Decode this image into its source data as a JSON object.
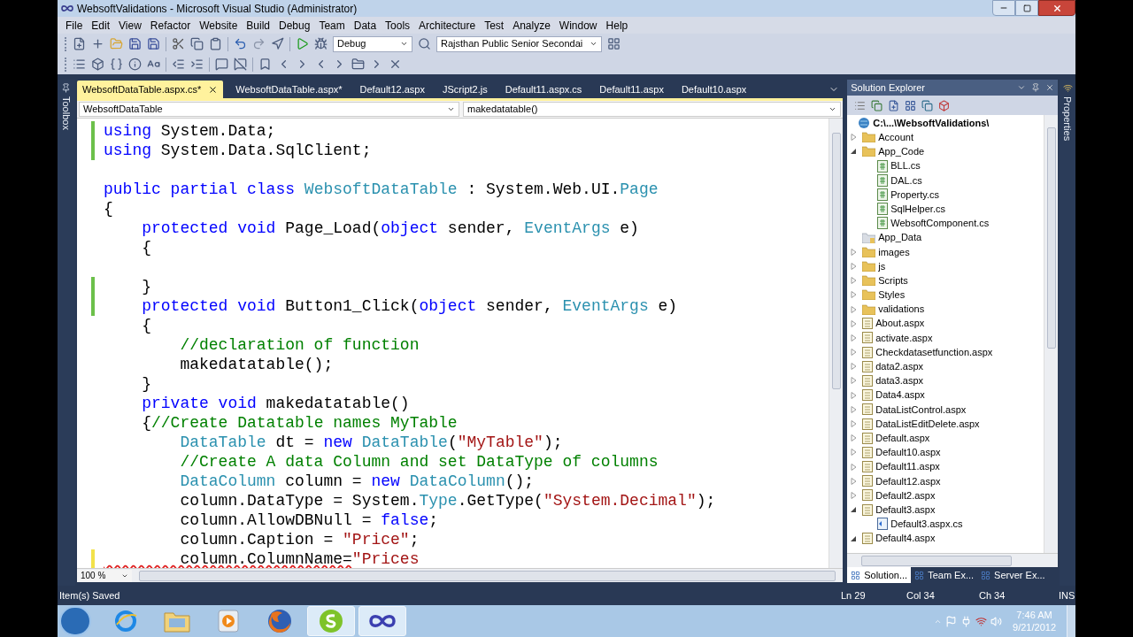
{
  "window": {
    "title": "WebsoftValidations - Microsoft Visual Studio (Administrator)"
  },
  "menu": [
    "File",
    "Edit",
    "View",
    "Refactor",
    "Website",
    "Build",
    "Debug",
    "Team",
    "Data",
    "Tools",
    "Architecture",
    "Test",
    "Analyze",
    "Window",
    "Help"
  ],
  "toolbar_1": [
    {
      "kind": "new"
    },
    {
      "kind": "add"
    },
    {
      "kind": "open"
    },
    {
      "kind": "save"
    },
    {
      "kind": "save-all"
    },
    {
      "kind": "sep"
    },
    {
      "kind": "cut"
    },
    {
      "kind": "copy"
    },
    {
      "kind": "paste"
    },
    {
      "kind": "sep"
    },
    {
      "kind": "undo"
    },
    {
      "kind": "redo"
    },
    {
      "kind": "nav"
    },
    {
      "kind": "sep"
    },
    {
      "kind": "play"
    },
    {
      "kind": "attach"
    },
    {
      "kind": "dropdown",
      "text": "Debug"
    },
    {
      "kind": "find"
    },
    {
      "kind": "dropdown",
      "text": "Rajsthan Public Senior Secondai"
    },
    {
      "kind": "layout"
    }
  ],
  "toolbar_2": [
    {
      "kind": "list"
    },
    {
      "kind": "members"
    },
    {
      "kind": "params"
    },
    {
      "kind": "quickinfo"
    },
    {
      "kind": "word"
    },
    {
      "kind": "sep"
    },
    {
      "kind": "outdent"
    },
    {
      "kind": "indent"
    },
    {
      "kind": "sep"
    },
    {
      "kind": "comment"
    },
    {
      "kind": "uncomment"
    },
    {
      "kind": "sep"
    },
    {
      "kind": "bookmark"
    },
    {
      "kind": "bookmark-prev"
    },
    {
      "kind": "bookmark-next"
    },
    {
      "kind": "bookmark-prev"
    },
    {
      "kind": "bookmark-next"
    },
    {
      "kind": "bookmark-folder"
    },
    {
      "kind": "bookmark-next"
    },
    {
      "kind": "bookmark-clear"
    }
  ],
  "editor_tabs": [
    {
      "label": "WebsoftDataTable.aspx.cs*",
      "selected": true
    },
    {
      "label": "WebsoftDataTable.aspx*",
      "selected": false
    },
    {
      "label": "Default12.aspx",
      "selected": false
    },
    {
      "label": "JScript2.js",
      "selected": false
    },
    {
      "label": "Default11.aspx.cs",
      "selected": false
    },
    {
      "label": "Default11.aspx",
      "selected": false
    },
    {
      "label": "Default10.aspx",
      "selected": false
    }
  ],
  "toolbox_label": "Toolbox",
  "properties_label": "Properties",
  "navigation": {
    "type_dropdown": "WebsoftDataTable",
    "member_dropdown": "makedatatable()"
  },
  "code_lines": [
    {
      "kind": "code",
      "modified": true,
      "saved": true,
      "tokens": [
        {
          "kind": "kw",
          "text": "using"
        },
        {
          "kind": "plain",
          "text": " System.Data;"
        }
      ]
    },
    {
      "kind": "code",
      "modified": true,
      "saved": true,
      "tokens": [
        {
          "kind": "kw",
          "text": "using"
        },
        {
          "kind": "plain",
          "text": " System.Data.SqlClient;"
        }
      ]
    },
    {
      "kind": "blank"
    },
    {
      "kind": "code",
      "tokens": [
        {
          "kind": "kw",
          "text": "public partial class "
        },
        {
          "kind": "type",
          "text": "WebsoftDataTable"
        },
        {
          "kind": "plain",
          "text": " : System.Web.UI."
        },
        {
          "kind": "type",
          "text": "Page"
        }
      ]
    },
    {
      "kind": "code",
      "tokens": [
        {
          "kind": "plain",
          "text": "{"
        }
      ]
    },
    {
      "kind": "code",
      "tokens": [
        {
          "kind": "kw",
          "text": "    protected void"
        },
        {
          "kind": "plain",
          "text": " Page_Load("
        },
        {
          "kind": "kw",
          "text": "object"
        },
        {
          "kind": "plain",
          "text": " sender, "
        },
        {
          "kind": "type",
          "text": "EventArgs"
        },
        {
          "kind": "plain",
          "text": " e)"
        }
      ]
    },
    {
      "kind": "code",
      "tokens": [
        {
          "kind": "plain",
          "text": "    {"
        }
      ]
    },
    {
      "kind": "blank"
    },
    {
      "kind": "code",
      "modified": true,
      "saved": true,
      "tokens": [
        {
          "kind": "plain",
          "text": "    }"
        }
      ]
    },
    {
      "kind": "code",
      "modified": true,
      "saved": true,
      "tokens": [
        {
          "kind": "kw",
          "text": "    protected void"
        },
        {
          "kind": "plain",
          "text": " Button1_Click("
        },
        {
          "kind": "kw",
          "text": "object"
        },
        {
          "kind": "plain",
          "text": " sender, "
        },
        {
          "kind": "type",
          "text": "EventArgs"
        },
        {
          "kind": "plain",
          "text": " e)"
        }
      ]
    },
    {
      "kind": "code",
      "tokens": [
        {
          "kind": "plain",
          "text": "    {"
        }
      ]
    },
    {
      "kind": "code",
      "tokens": [
        {
          "kind": "cmt",
          "text": "        //declaration of function"
        }
      ]
    },
    {
      "kind": "code",
      "tokens": [
        {
          "kind": "plain",
          "text": "        makedatatable();"
        }
      ]
    },
    {
      "kind": "code",
      "tokens": [
        {
          "kind": "plain",
          "text": "    }"
        }
      ]
    },
    {
      "kind": "code",
      "tokens": [
        {
          "kind": "kw",
          "text": "    private void"
        },
        {
          "kind": "plain",
          "text": " makedatatable()"
        }
      ]
    },
    {
      "kind": "code",
      "tokens": [
        {
          "kind": "plain",
          "text": "    {"
        },
        {
          "kind": "cmt",
          "text": "//Create Datatable names MyTable"
        }
      ]
    },
    {
      "kind": "code",
      "tokens": [
        {
          "kind": "type",
          "text": "        DataTable"
        },
        {
          "kind": "plain",
          "text": " dt = "
        },
        {
          "kind": "kw",
          "text": "new "
        },
        {
          "kind": "type",
          "text": "DataTable"
        },
        {
          "kind": "plain",
          "text": "("
        },
        {
          "kind": "str",
          "text": "\"MyTable\""
        },
        {
          "kind": "plain",
          "text": ");"
        }
      ]
    },
    {
      "kind": "code",
      "tokens": [
        {
          "kind": "cmt",
          "text": "        //Create A data Column and set DataType of columns"
        }
      ]
    },
    {
      "kind": "code",
      "tokens": [
        {
          "kind": "type",
          "text": "        DataColumn"
        },
        {
          "kind": "plain",
          "text": " column = "
        },
        {
          "kind": "kw",
          "text": "new "
        },
        {
          "kind": "type",
          "text": "DataColumn"
        },
        {
          "kind": "plain",
          "text": "();"
        }
      ]
    },
    {
      "kind": "code",
      "tokens": [
        {
          "kind": "plain",
          "text": "        column.DataType = System."
        },
        {
          "kind": "type",
          "text": "Type"
        },
        {
          "kind": "plain",
          "text": ".GetType("
        },
        {
          "kind": "str",
          "text": "\"System.Decimal\""
        },
        {
          "kind": "plain",
          "text": ");"
        }
      ]
    },
    {
      "kind": "code",
      "tokens": [
        {
          "kind": "plain",
          "text": "        column.AllowDBNull = "
        },
        {
          "kind": "kw",
          "text": "false"
        },
        {
          "kind": "plain",
          "text": ";"
        }
      ]
    },
    {
      "kind": "code",
      "tokens": [
        {
          "kind": "plain",
          "text": "        column.Caption = "
        },
        {
          "kind": "str",
          "text": "\"Price\""
        },
        {
          "kind": "plain",
          "text": ";"
        }
      ]
    },
    {
      "kind": "code",
      "modified": true,
      "saved": false,
      "tokens": [
        {
          "kind": "plain",
          "text": "        column.ColumnName=",
          "squiggle": true
        },
        {
          "kind": "str",
          "text": "\"Prices"
        }
      ]
    }
  ],
  "zoom": "100 %",
  "solution_explorer": {
    "title": "Solution Explorer",
    "tree": [
      {
        "kind": "project",
        "label": "C:\\...\\WebsoftValidations\\",
        "children": [
          {
            "kind": "folder",
            "label": "Account",
            "expanded": false
          },
          {
            "kind": "folder",
            "label": "App_Code",
            "expanded": true,
            "children": [
              {
                "kind": "cs",
                "label": "BLL.cs"
              },
              {
                "kind": "cs",
                "label": "DAL.cs"
              },
              {
                "kind": "cs",
                "label": "Property.cs"
              },
              {
                "kind": "cs",
                "label": "SqlHelper.cs"
              },
              {
                "kind": "cs",
                "label": "WebsoftComponent.cs"
              }
            ]
          },
          {
            "kind": "special-folder",
            "label": "App_Data"
          },
          {
            "kind": "folder",
            "label": "images",
            "expanded": false
          },
          {
            "kind": "folder",
            "label": "js",
            "expanded": false
          },
          {
            "kind": "folder",
            "label": "Scripts",
            "expanded": false
          },
          {
            "kind": "folder",
            "label": "Styles",
            "expanded": false
          },
          {
            "kind": "folder",
            "label": "validations",
            "expanded": false
          },
          {
            "kind": "page",
            "label": "About.aspx",
            "expanded": false
          },
          {
            "kind": "page",
            "label": "activate.aspx",
            "expanded": false
          },
          {
            "kind": "page",
            "label": "Checkdatasetfunction.aspx",
            "expanded": false
          },
          {
            "kind": "page",
            "label": "data2.aspx",
            "expanded": false
          },
          {
            "kind": "page",
            "label": "data3.aspx",
            "expanded": false
          },
          {
            "kind": "page",
            "label": "Data4.aspx",
            "expanded": false
          },
          {
            "kind": "page",
            "label": "DataListControl.aspx",
            "expanded": false
          },
          {
            "kind": "page",
            "label": "DataListEditDelete.aspx",
            "expanded": false
          },
          {
            "kind": "page",
            "label": "Default.aspx",
            "expanded": false
          },
          {
            "kind": "page",
            "label": "Default10.aspx",
            "expanded": false
          },
          {
            "kind": "page",
            "label": "Default11.aspx",
            "expanded": false
          },
          {
            "kind": "page",
            "label": "Default12.aspx",
            "expanded": false
          },
          {
            "kind": "page",
            "label": "Default2.aspx",
            "expanded": false
          },
          {
            "kind": "page",
            "label": "Default3.aspx",
            "expanded": true,
            "children": [
              {
                "kind": "codebehind",
                "label": "Default3.aspx.cs"
              }
            ]
          },
          {
            "kind": "page",
            "label": "Default4.aspx",
            "expanded": true
          }
        ]
      }
    ],
    "bottom_tabs": [
      {
        "label": "Solution...",
        "selected": true
      },
      {
        "label": "Team Ex...",
        "selected": false
      },
      {
        "label": "Server Ex...",
        "selected": false
      }
    ]
  },
  "status_bar": {
    "message": "Item(s) Saved",
    "line": "Ln 29",
    "column": "Col 34",
    "char": "Ch 34",
    "mode": "INS"
  },
  "taskbar": {
    "apps": [
      {
        "kind": "browser",
        "active": false
      },
      {
        "kind": "files",
        "active": false
      },
      {
        "kind": "media",
        "active": false
      },
      {
        "kind": "firefox",
        "active": false
      },
      {
        "kind": "chat",
        "active": true
      },
      {
        "kind": "infinity",
        "active": true
      }
    ],
    "time": "7:46 AM",
    "date": "9/21/2012"
  }
}
